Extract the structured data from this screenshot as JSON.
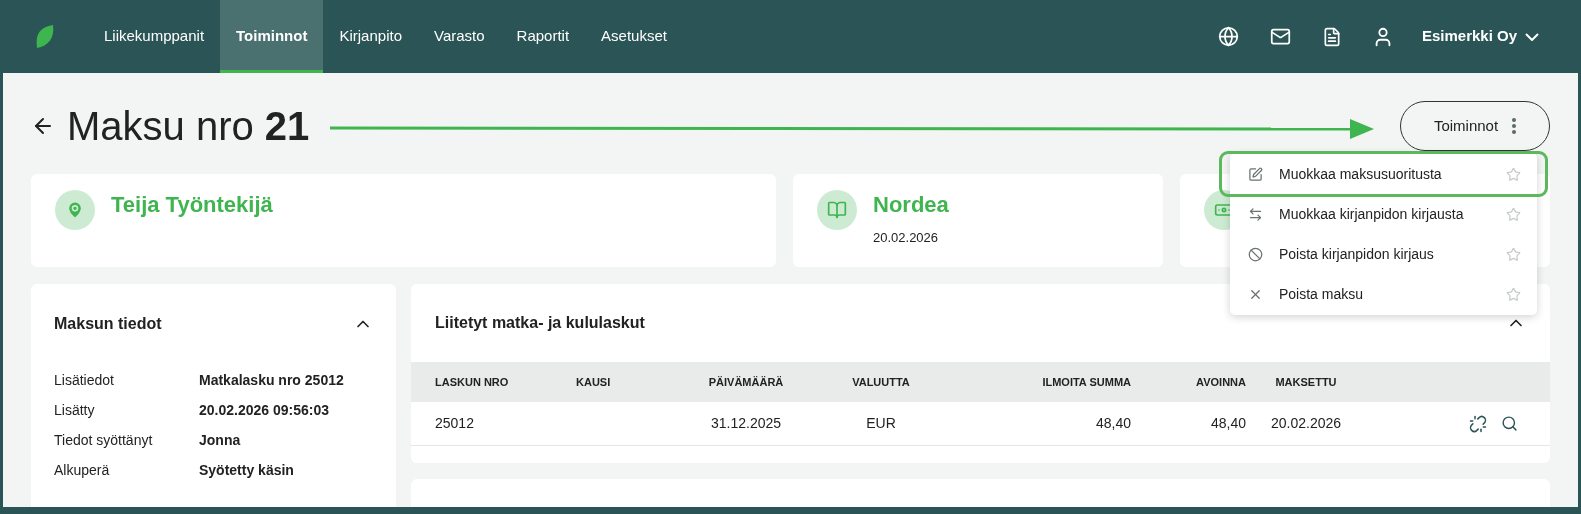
{
  "nav": {
    "items": [
      {
        "label": "Liikekumppanit",
        "selected": false
      },
      {
        "label": "Toiminnot",
        "selected": true
      },
      {
        "label": "Kirjanpito",
        "selected": false
      },
      {
        "label": "Varasto",
        "selected": false
      },
      {
        "label": "Raportit",
        "selected": false
      },
      {
        "label": "Asetukset",
        "selected": false
      }
    ],
    "company": "Esimerkki Oy"
  },
  "page": {
    "title": "Maksu nro **21**",
    "actions_button": "Toiminnot"
  },
  "actions_menu": [
    {
      "kind": "edit",
      "label": "Muokkaa maksusuoritusta",
      "highlighted": true
    },
    {
      "kind": "swap",
      "label": "Muokkaa kirjanpidon kirjausta",
      "highlighted": false
    },
    {
      "kind": "block",
      "label": "Poista kirjanpidon kirjaus",
      "highlighted": false
    },
    {
      "kind": "close",
      "label": "Poista maksu",
      "highlighted": false
    }
  ],
  "summary_cards": [
    {
      "kind": "partner",
      "title": "Teija Työntekijä"
    },
    {
      "kind": "bank",
      "title": "Nordea",
      "subtitle": "20.02.2026"
    },
    {
      "kind": "money"
    }
  ],
  "details": {
    "title": "Maksun tiedot",
    "rows": [
      {
        "label": "Lisätiedot",
        "value": "Matkalasku nro 25012"
      },
      {
        "label": "Lisätty",
        "value": "20.02.2026 09:56:03"
      },
      {
        "label": "Tiedot syöttänyt",
        "value": "Jonna"
      },
      {
        "label": "Alkuperä",
        "value": "Syötetty käsin"
      }
    ]
  },
  "table": {
    "title": "Liitetyt matka- ja kululaskut",
    "columns": [
      "LASKUN NRO",
      "KAUSI",
      "PÄIVÄMÄÄRÄ",
      "VALUUTTA",
      "ILMOITA SUMMA",
      "AVOINNA",
      "MAKSETTU"
    ],
    "rows": [
      {
        "cells": [
          "25012",
          "",
          "31.12.2025",
          "EUR",
          "48,40",
          "48,40",
          "20.02.2026"
        ]
      }
    ]
  }
}
